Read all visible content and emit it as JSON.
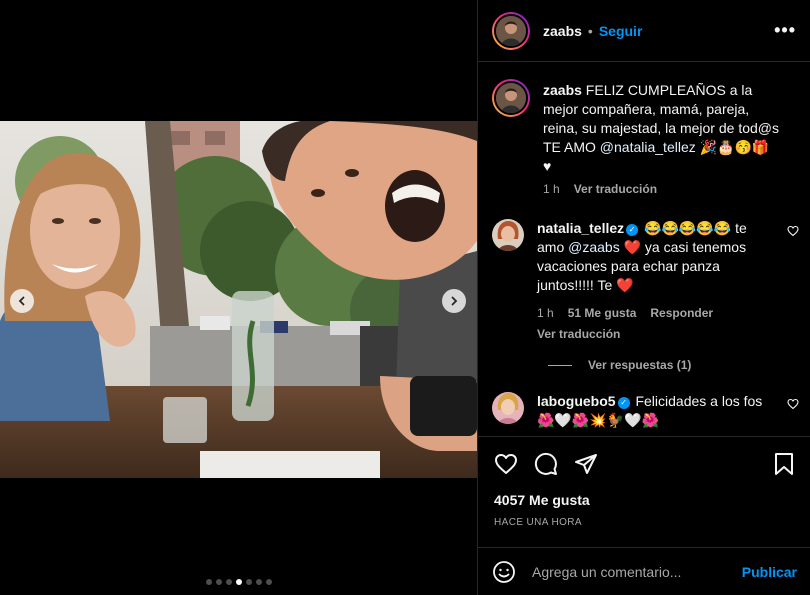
{
  "post": {
    "author": "zaabs",
    "separator": "•",
    "follow_label": "Seguir",
    "more_label": "•••"
  },
  "caption": {
    "username": "zaabs",
    "text": " FELIZ CUMPLEAÑOS a la mejor compañera, mamá, pareja, reina, su majestad, la mejor de tod@s",
    "line2_prefix": "TE AMO ",
    "mention": "@natalia_tellez",
    "emojis": " 🎉🎂😚🎁",
    "heart": "♥",
    "time": "1 h",
    "translate": "Ver traducción"
  },
  "comments": [
    {
      "username": "natalia_tellez",
      "verified": true,
      "text_before": " 😂😂😂😂😂 te amo ",
      "mention": "@zaabs",
      "text_after": " ❤️ ya casi tenemos vacaciones para echar panza juntos!!!!! Te ❤️",
      "time": "1 h",
      "likes": "51 Me gusta",
      "reply": "Responder",
      "translate": "Ver traducción",
      "view_replies": "Ver respuestas (1)"
    },
    {
      "username": "laboguebo5",
      "verified": true,
      "text": " Felicidades a los fos 🌺🤍🌺💥🐓🤍🌺"
    }
  ],
  "likes_count": "4057 Me gusta",
  "timestamp": "HACE UNA HORA",
  "comment_input": {
    "placeholder": "Agrega un comentario...",
    "post_label": "Publicar"
  },
  "carousel": {
    "total": 7,
    "active_index": 3
  },
  "colors": {
    "accent": "#0095f6",
    "background": "#000000",
    "like_red": "#ed4956"
  }
}
